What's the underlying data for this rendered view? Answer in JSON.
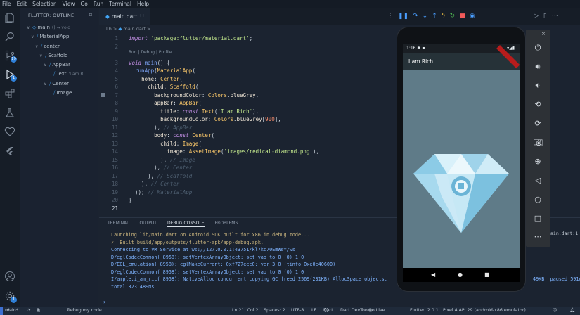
{
  "menu": [
    "File",
    "Edit",
    "Selection",
    "View",
    "Go",
    "Run",
    "Terminal",
    "Help"
  ],
  "sidebar": {
    "title": "FLUTTER: OUTLINE",
    "tree": [
      {
        "label": "main",
        "detail": "() → void",
        "depth": 0,
        "icon": "flutter"
      },
      {
        "label": "MaterialApp",
        "detail": "",
        "depth": 1,
        "icon": "flutter"
      },
      {
        "label": "center",
        "detail": "",
        "depth": 2,
        "icon": "flutter"
      },
      {
        "label": "Scaffold",
        "detail": "",
        "depth": 3,
        "icon": "flutter"
      },
      {
        "label": "AppBar",
        "detail": "",
        "depth": 4,
        "icon": "flutter"
      },
      {
        "label": "Text",
        "detail": "'I am Ri...",
        "depth": 5,
        "icon": "flutter"
      },
      {
        "label": "Center",
        "detail": "",
        "depth": 4,
        "icon": "flutter"
      },
      {
        "label": "Image",
        "detail": "",
        "depth": 5,
        "icon": "flutter"
      }
    ]
  },
  "editor": {
    "tab_label": "main.dart",
    "tab_modified": "U",
    "breadcrumb": [
      "lib",
      "main.dart",
      "..."
    ],
    "codelens": "Run | Debug | Profile",
    "current_line": 21
  },
  "panel": {
    "tabs": [
      "TERMINAL",
      "OUTPUT",
      "DEBUG CONSOLE",
      "PROBLEMS"
    ],
    "active_tab": "DEBUG CONSOLE",
    "lines": [
      "Launching lib/main.dart on Android SDK built for x86 in debug mode...",
      "✓  Built build/app/outputs/flutter-apk/app-debug.apk.",
      "Connecting to VM Service at ws://127.0.0.1:43751/kl7kc70EmWs=/ws",
      "D/eglCodecCommon( 8958): setVertexArrayObject: set vao to 0 (0) 1 0",
      "D/EGL_emulation( 8958): eglMakeCurrent: 0xf727eec0: ver 3 0 (tinfo 0xe0c40600)",
      "D/eglCodecCommon( 8958): setVertexArrayObject: set vao to 0 (0) 1 0",
      "I/ample.i_am_ric( 8958): NativeAlloc concurrent copying GC freed 2569(231KB) AllocSpace objects,",
      "total 323.489ms"
    ],
    "trail_text": "49KB, paused 591us"
  },
  "status": {
    "branch": "main*",
    "sync": "⟳",
    "errors": "0",
    "warnings": "0",
    "debug": "Debug my code",
    "position": "Ln 21, Col 2",
    "spaces": "Spaces: 2",
    "encoding": "UTF-8",
    "eol": "LF",
    "language": "Dart",
    "devtools": "Dart DevTools",
    "golive": "Go Live",
    "flutter": "Flutter: 2.0.1",
    "device": "Pixel 4 API 29 (android-x86 emulator)"
  },
  "emulator": {
    "time": "1:16",
    "app_title": "I am Rich",
    "toolbar_close": "×",
    "toolbar_min": "–"
  },
  "right_strip": "ain.dart:1",
  "colors": {
    "accent": "#42a5f5",
    "string": "#c3e88d",
    "keyword": "#c792ea",
    "class": "#ffcb6b",
    "screen_bg": "#5f7b88",
    "appbar_bg": "#263238"
  }
}
